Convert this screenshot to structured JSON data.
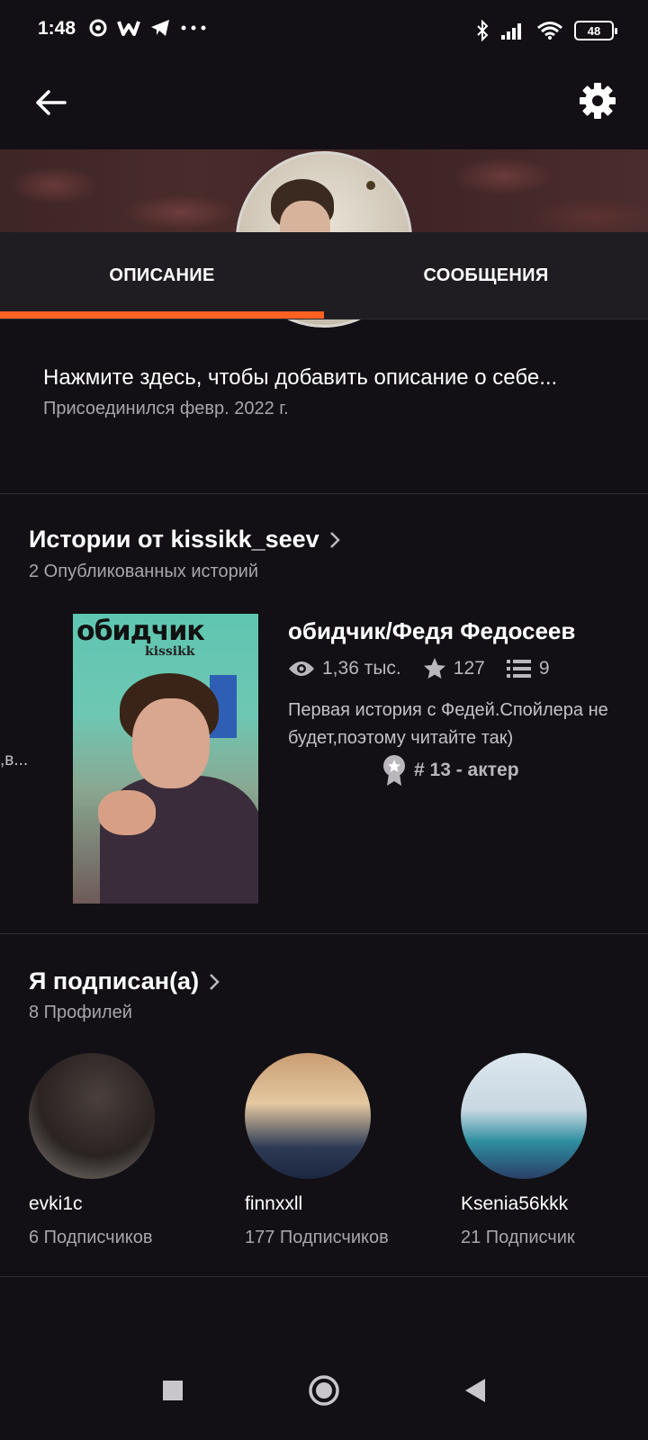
{
  "status_bar": {
    "time": "1:48",
    "battery": "48"
  },
  "tabs": [
    {
      "label": "ОПИСАНИЕ",
      "active": true
    },
    {
      "label": "СООБЩЕНИЯ",
      "active": false
    }
  ],
  "description": {
    "prompt": "Нажмите здесь, чтобы добавить описание о себе...",
    "joined": "Присоединился февр. 2022 г."
  },
  "stories": {
    "title": "Истории от kissikk_seev",
    "subtitle": "2 Опубликованных историй",
    "truncated_prev": ",в...",
    "item": {
      "cover_title": "обидчик",
      "cover_author": "kissikk",
      "title": "обидчик/Федя Федосеев",
      "views": "1,36 тыс.",
      "votes": "127",
      "parts": "9",
      "description": "Первая история с Федей.Спойлера не будет,поэтому читайте так)",
      "rank": "# 13 - актер"
    }
  },
  "following": {
    "title": "Я подписан(а)",
    "subtitle": "8 Профилей",
    "profiles": [
      {
        "name": "evki1c",
        "followers": "6 Подписчиков"
      },
      {
        "name": "finnxxll",
        "followers": "177 Подписчиков"
      },
      {
        "name": "Ksenia56kkk",
        "followers": "21 Подписчик"
      }
    ]
  },
  "colors": {
    "background": "#121014",
    "accent": "#ff6122",
    "tab_bar": "#1f1d21"
  }
}
